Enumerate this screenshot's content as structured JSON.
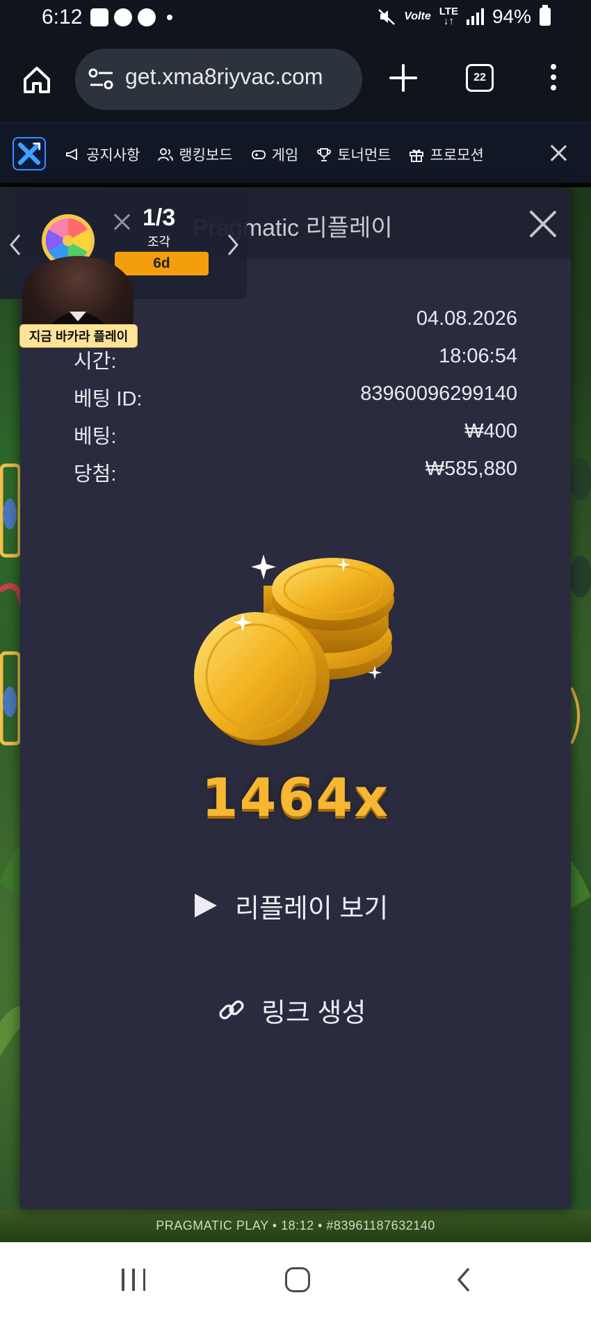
{
  "status_bar": {
    "time": "6:12",
    "lte_top": "LTE",
    "volte": "Volte",
    "battery": "94%"
  },
  "browser": {
    "url": "get.xma8riyvac.com",
    "tab_count": "22"
  },
  "site_nav": {
    "items": [
      {
        "label": "공지사항",
        "icon": "megaphone-icon"
      },
      {
        "label": "랭킹보드",
        "icon": "users-icon"
      },
      {
        "label": "게임",
        "icon": "gamepad-icon"
      },
      {
        "label": "토너먼트",
        "icon": "trophy-icon"
      },
      {
        "label": "프로모션",
        "icon": "gift-icon"
      }
    ]
  },
  "widget": {
    "count": "1/3",
    "label": "조각",
    "badge": "6d"
  },
  "avatar_badge": "지금 바카라 플레이",
  "modal": {
    "title": "Pragmatic 리플레이",
    "details": [
      {
        "label": "",
        "value": "04.08.2026"
      },
      {
        "label": "시간:",
        "value": "18:06:54"
      },
      {
        "label": "베팅 ID:",
        "value": "83960096299140"
      },
      {
        "label": "베팅:",
        "value": "₩400"
      },
      {
        "label": "당첨:",
        "value": "₩585,880"
      }
    ],
    "multiplier": "1464x",
    "replay_label": "리플레이 보기",
    "link_label": "링크 생성"
  },
  "game_footer": "PRAGMATIC PLAY • 18:12 • #83961187632140",
  "colors": {
    "modal_bg": "#2a2b3e",
    "header_bg": "#202131",
    "multiplier": "#f7b733",
    "badge": "#f59e0b"
  }
}
